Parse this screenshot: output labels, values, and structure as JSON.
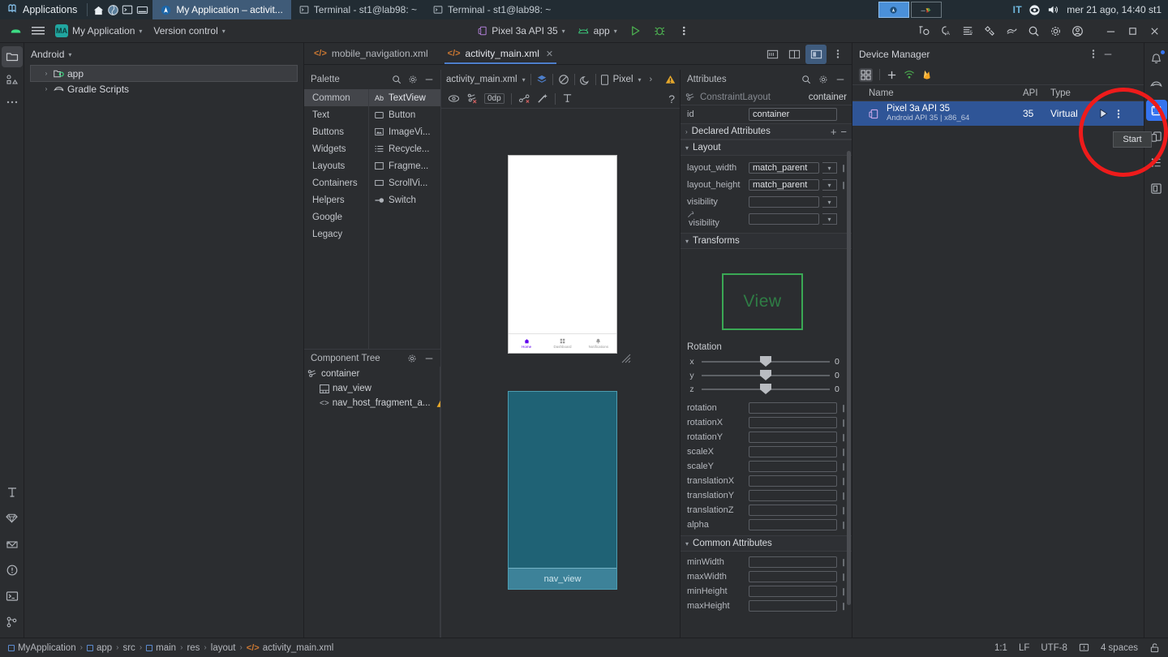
{
  "os_bar": {
    "applications_label": "Applications",
    "icons": [
      "home-icon",
      "browser-icon",
      "terminal-icon",
      "files-icon"
    ],
    "tasks": [
      {
        "label": "My Application – activit...",
        "icon": "android-studio-icon",
        "active": true
      },
      {
        "label": "Terminal - st1@lab98: ~",
        "icon": "terminal-icon",
        "active": false
      },
      {
        "label": "Terminal - st1@lab98: ~",
        "icon": "terminal-icon",
        "active": false
      }
    ],
    "tray": [
      "workspace-1",
      "workspace-2"
    ],
    "language": "IT",
    "clock": "mer 21 ago, 14:40 st1"
  },
  "toolbar": {
    "android_icon": "android-logo-icon",
    "menu_icon": "hamburger-menu-icon",
    "project_badge": "MA",
    "project_name": "My Application",
    "version_control": "Version control",
    "device_target": "Pixel 3a API 35",
    "run_config": "app",
    "run_label": "Run",
    "debug_label": "Debug",
    "more_label": "More actions",
    "right_icons": [
      "code-with-me-icon",
      "ai-assistant-icon",
      "notifications-list-icon",
      "build-icon",
      "profiler-icon",
      "search-icon",
      "settings-gear-icon",
      "account-icon"
    ],
    "window_minimize": "minimize-icon",
    "window_maximize": "maximize-icon",
    "window_close": "close-icon"
  },
  "left_rail": {
    "top": [
      "project-folder-icon",
      "commit-icon",
      "more-tool-windows-icon"
    ],
    "bottom": [
      "structure-icon",
      "gemini-icon",
      "app-quality-icon",
      "problems-icon",
      "terminal-icon",
      "version-control-icon"
    ]
  },
  "right_rail": {
    "items": [
      "notifications-bell-icon",
      "gradle-icon",
      "device-manager-icon",
      "running-devices-icon",
      "device-explorer-icon",
      "emulator-icon"
    ]
  },
  "project": {
    "title": "Android",
    "tree": [
      {
        "label": "app",
        "icon": "module-folder-icon",
        "selected": true,
        "indent": 0
      },
      {
        "label": "Gradle Scripts",
        "icon": "gradle-icon",
        "selected": false,
        "indent": 0
      }
    ]
  },
  "editor": {
    "tabs": [
      {
        "label": "mobile_navigation.xml",
        "active": false,
        "closable": false
      },
      {
        "label": "activity_main.xml",
        "active": true,
        "closable": true
      }
    ],
    "right_icons": [
      "code-view-icon",
      "split-view-icon",
      "design-view-icon",
      "editor-options-icon"
    ]
  },
  "palette": {
    "title": "Palette",
    "search_icon": "search-icon",
    "settings_icon": "gear-icon",
    "minimize_icon": "minimize-icon",
    "categories": [
      {
        "label": "Common",
        "selected": true
      },
      {
        "label": "Text",
        "selected": false
      },
      {
        "label": "Buttons",
        "selected": false
      },
      {
        "label": "Widgets",
        "selected": false
      },
      {
        "label": "Layouts",
        "selected": false
      },
      {
        "label": "Containers",
        "selected": false
      },
      {
        "label": "Helpers",
        "selected": false
      },
      {
        "label": "Google",
        "selected": false
      },
      {
        "label": "Legacy",
        "selected": false
      }
    ],
    "items": [
      {
        "label": "TextView",
        "glyph": "Ab",
        "selected": true
      },
      {
        "label": "Button",
        "glyph": "▭",
        "selected": false
      },
      {
        "label": "ImageVi...",
        "glyph": "🖼",
        "selected": false
      },
      {
        "label": "Recycle...",
        "glyph": "☰",
        "selected": false
      },
      {
        "label": "Fragme...",
        "glyph": "▭",
        "selected": false
      },
      {
        "label": "ScrollVi...",
        "glyph": "▭",
        "selected": false
      },
      {
        "label": "Switch",
        "glyph": "—",
        "selected": false
      }
    ]
  },
  "component_tree": {
    "title": "Component Tree",
    "settings_icon": "gear-icon",
    "minimize_icon": "minimize-icon",
    "nodes": [
      {
        "label": "container",
        "icon": "constraint-layout-icon",
        "indent": 0,
        "warning": false
      },
      {
        "label": "nav_view",
        "icon": "bottom-nav-icon",
        "indent": 1,
        "warning": false
      },
      {
        "label": "nav_host_fragment_a...",
        "icon": "fragment-icon",
        "indent": 1,
        "warning": true
      }
    ]
  },
  "design_toolbar": {
    "file_name": "activity_main.xml",
    "design_mode_icon": "design-surface-icon",
    "blueprint_icon": "blueprint-icon",
    "theme_icon": "night-mode-icon",
    "device_label": "Pixel",
    "next_icon": "chevron-right-icon",
    "warning_icon": "warning-triangle-icon",
    "row2": {
      "view_options_icon": "eye-icon",
      "constraints_icon": "clear-constraints-icon",
      "margin_value": "0dp",
      "autoconnect_icon": "autoconnect-icon",
      "infer_icon": "magic-wand-icon",
      "guideline_icon": "guideline-icon",
      "help_icon": "question-mark-icon"
    }
  },
  "preview": {
    "bottom_nav": [
      {
        "label": "Home",
        "active": true
      },
      {
        "label": "Dashboard",
        "active": false
      },
      {
        "label": "Notifications",
        "active": false
      }
    ],
    "blueprint_label": "nav_view"
  },
  "attributes": {
    "title": "Attributes",
    "search_icon": "search-icon",
    "settings_icon": "gear-icon",
    "minimize_icon": "minimize-icon",
    "component_type": "ConstraintLayout",
    "component_id": "container",
    "id_label": "id",
    "id_value": "container",
    "declared_attributes": "Declared Attributes",
    "sections": {
      "layout": "Layout",
      "transforms": "Transforms",
      "common": "Common Attributes"
    },
    "layout_rows": [
      {
        "label": "layout_width",
        "value": "match_parent",
        "dropdown": true,
        "pin": true
      },
      {
        "label": "layout_height",
        "value": "match_parent",
        "dropdown": true,
        "pin": true
      },
      {
        "label": "visibility",
        "value": "",
        "dropdown": true,
        "pin": false
      },
      {
        "label": "visibility",
        "value": "",
        "dropdown": true,
        "pin": false,
        "tools": true
      }
    ],
    "transform_preview_label": "View",
    "rotation_label": "Rotation",
    "rotation_sliders": [
      {
        "axis": "x",
        "value": "0"
      },
      {
        "axis": "y",
        "value": "0"
      },
      {
        "axis": "z",
        "value": "0"
      }
    ],
    "transform_rows": [
      {
        "label": "rotation",
        "value": ""
      },
      {
        "label": "rotationX",
        "value": ""
      },
      {
        "label": "rotationY",
        "value": ""
      },
      {
        "label": "scaleX",
        "value": ""
      },
      {
        "label": "scaleY",
        "value": ""
      },
      {
        "label": "translationX",
        "value": ""
      },
      {
        "label": "translationY",
        "value": ""
      },
      {
        "label": "translationZ",
        "value": ""
      },
      {
        "label": "alpha",
        "value": ""
      }
    ],
    "common_rows": [
      {
        "label": "minWidth",
        "value": ""
      },
      {
        "label": "maxWidth",
        "value": ""
      },
      {
        "label": "minHeight",
        "value": ""
      },
      {
        "label": "maxHeight",
        "value": ""
      }
    ]
  },
  "device_manager": {
    "title": "Device Manager",
    "more_icon": "more-options-icon",
    "minimize_icon": "minimize-icon",
    "tools": [
      "device-pairing-icon",
      "add-device-icon",
      "wifi-pair-icon",
      "firebase-icon"
    ],
    "columns": {
      "name": "Name",
      "api": "API",
      "type": "Type"
    },
    "devices": [
      {
        "name": "Pixel 3a API 35",
        "subtitle": "Android API 35 | x86_64",
        "api": "35",
        "type": "Virtual",
        "selected": true,
        "actions": [
          "start-button",
          "overflow-menu"
        ]
      }
    ],
    "tooltip": "Start",
    "annotation": {
      "shape": "circle",
      "color": "#ee1b1b"
    }
  },
  "status_bar": {
    "breadcrumbs": [
      "MyApplication",
      "app",
      "src",
      "main",
      "res",
      "layout",
      "activity_main.xml"
    ],
    "caret_position": "1:1",
    "line_separator": "LF",
    "encoding": "UTF-8",
    "indent": "4 spaces",
    "readonly_icon": "lock-open-icon",
    "inspection_icon": "inspection-icon"
  },
  "colors": {
    "accent_blue": "#3574f0",
    "selection_blue": "#2f5597",
    "annotation_red": "#ee1b1b",
    "panel_bg": "#2b2d30",
    "blueprint": "#1f6275",
    "xml_orange": "#cc7832",
    "green": "#3aa854"
  }
}
